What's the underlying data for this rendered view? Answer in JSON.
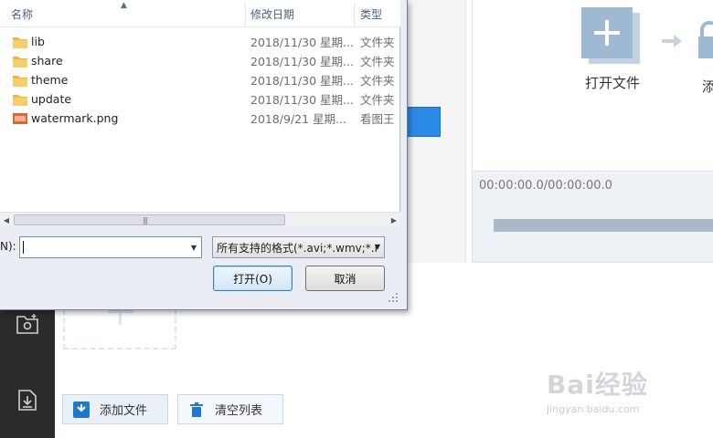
{
  "app": {
    "open_file_label": "打开文件",
    "add_label_partial": "添",
    "timecode": "00:00:00.0/00:00:00.0",
    "add_files_button": "添加文件",
    "clear_list_button": "清空列表",
    "watermark_main": "Bai经验",
    "watermark_sub": "jingyan.baidu.com"
  },
  "dialog": {
    "columns": {
      "name": "名称",
      "modified": "修改日期",
      "type": "类型"
    },
    "files": [
      {
        "name": "lib",
        "date": "2018/11/30 星期...",
        "type": "文件夹",
        "icon": "folder-icon"
      },
      {
        "name": "share",
        "date": "2018/11/30 星期...",
        "type": "文件夹",
        "icon": "folder-icon"
      },
      {
        "name": "theme",
        "date": "2018/11/30 星期...",
        "type": "文件夹",
        "icon": "folder-icon"
      },
      {
        "name": "update",
        "date": "2018/11/30 星期...",
        "type": "文件夹",
        "icon": "folder-icon"
      },
      {
        "name": "watermark.png",
        "date": "2018/9/21 星期...",
        "type": "看图王",
        "icon": "png-file-icon"
      }
    ],
    "filename_label": "N):",
    "filename_value": "",
    "filter_value": "所有支持的格式(*.avi;*.wmv;*.r",
    "open_button": "打开(O)",
    "cancel_button": "取消"
  },
  "colors": {
    "accent_blue": "#2b8ae6",
    "sidebar_dark": "#2b2b2b",
    "progress_track": "#a9b9c8"
  }
}
